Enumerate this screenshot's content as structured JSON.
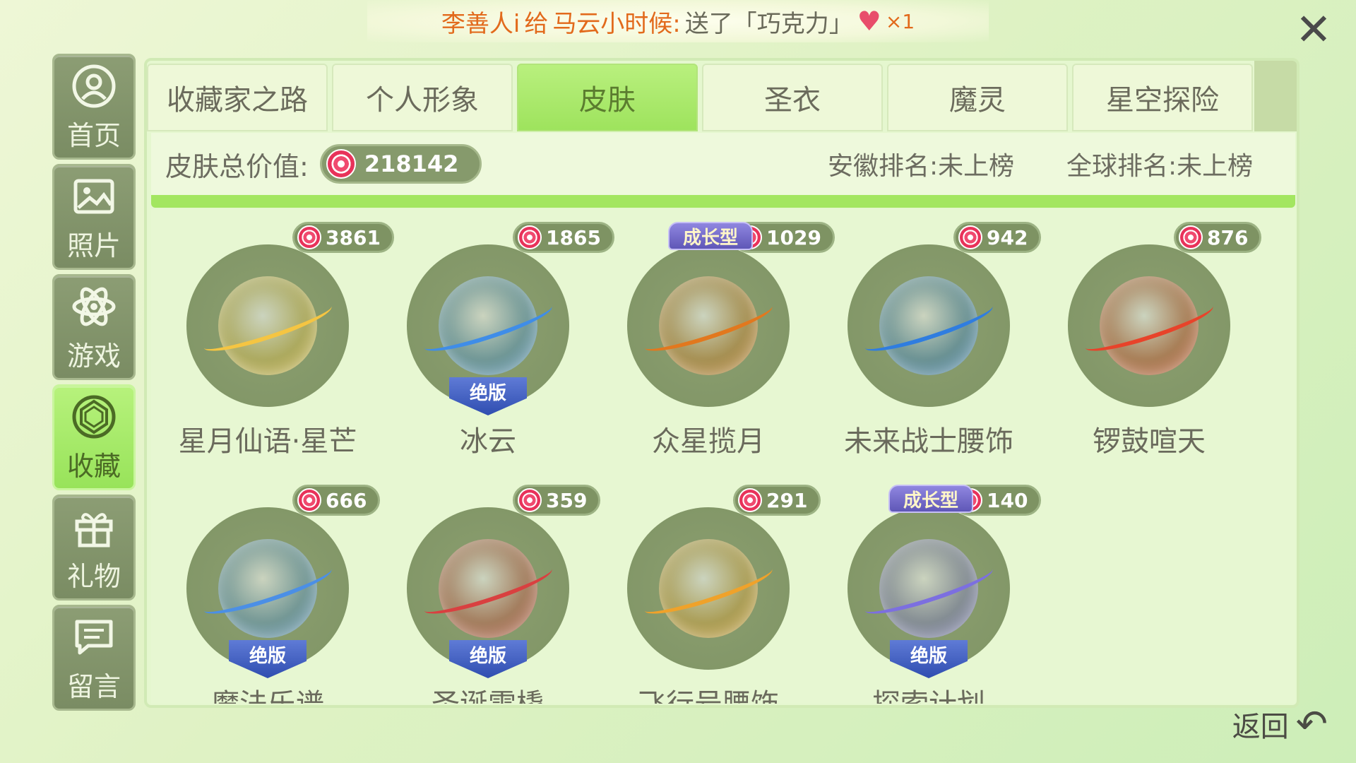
{
  "notice": {
    "sender": "李善人i",
    "verb": "给",
    "recipient": "马云小时候:",
    "action": "送了「巧克力」",
    "gift_icon": "heart-chocolate-icon",
    "count": "×1"
  },
  "sidebar": {
    "items": [
      {
        "label": "首页",
        "icon": "home-icon"
      },
      {
        "label": "照片",
        "icon": "photo-icon"
      },
      {
        "label": "游戏",
        "icon": "atom-icon"
      },
      {
        "label": "收藏",
        "icon": "collection-icon"
      },
      {
        "label": "礼物",
        "icon": "gift-icon"
      },
      {
        "label": "留言",
        "icon": "message-icon"
      }
    ],
    "active_index": 3
  },
  "tabs": [
    {
      "label": "收藏家之路"
    },
    {
      "label": "个人形象"
    },
    {
      "label": "皮肤"
    },
    {
      "label": "圣衣"
    },
    {
      "label": "魔灵"
    },
    {
      "label": "星空探险"
    }
  ],
  "active_tab_index": 2,
  "info": {
    "total_label": "皮肤总价值:",
    "total_value": "218142",
    "province_rank": "安徽排名:未上榜",
    "global_rank": "全球排名:未上榜"
  },
  "items": [
    {
      "name": "星月仙语·星芒",
      "price": "3861",
      "growth": "",
      "limited": "",
      "ring_color": "#f5c542"
    },
    {
      "name": "冰云",
      "price": "1865",
      "growth": "",
      "limited": "绝版",
      "ring_color": "#3f8de8"
    },
    {
      "name": "众星揽月",
      "price": "1029",
      "growth": "成长型",
      "limited": "",
      "ring_color": "#e2781e"
    },
    {
      "name": "未来战士腰饰",
      "price": "942",
      "growth": "",
      "limited": "",
      "ring_color": "#2f7de0"
    },
    {
      "name": "锣鼓喧天",
      "price": "876",
      "growth": "",
      "limited": "",
      "ring_color": "#e8432a"
    },
    {
      "name": "魔法乐谱",
      "price": "666",
      "growth": "",
      "limited": "绝版",
      "ring_color": "#4b8fe6"
    },
    {
      "name": "圣诞雪橇",
      "price": "359",
      "growth": "",
      "limited": "绝版",
      "ring_color": "#d94040"
    },
    {
      "name": "飞行号腰饰",
      "price": "291",
      "growth": "",
      "limited": "",
      "ring_color": "#f0a22a"
    },
    {
      "name": "探索计划",
      "price": "140",
      "growth": "成长型",
      "limited": "绝版",
      "ring_color": "#7c6fe0"
    }
  ],
  "back_label": "返回"
}
